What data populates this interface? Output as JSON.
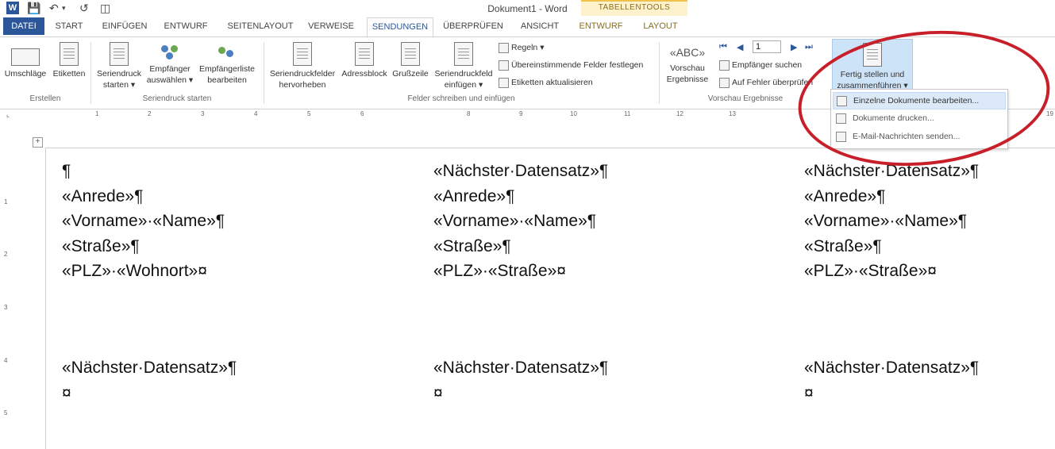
{
  "window": {
    "title": "Dokument1 - Word",
    "context_group": "TABELLENTOOLS"
  },
  "quick_access": {
    "icons": [
      "word-app-icon",
      "save-icon",
      "undo-icon",
      "redo-icon",
      "customize-icon"
    ]
  },
  "tabs": [
    {
      "label": "DATEI"
    },
    {
      "label": "START"
    },
    {
      "label": "EINFÜGEN"
    },
    {
      "label": "ENTWURF"
    },
    {
      "label": "SEITENLAYOUT"
    },
    {
      "label": "VERWEISE"
    },
    {
      "label": "SENDUNGEN"
    },
    {
      "label": "ÜBERPRÜFEN"
    },
    {
      "label": "ANSICHT"
    },
    {
      "label": "ENTWURF"
    },
    {
      "label": "LAYOUT"
    }
  ],
  "ribbon": {
    "groups": {
      "erstellen": "Erstellen",
      "seriendruck_starten": "Seriendruck starten",
      "felder": "Felder schreiben und einfügen",
      "vorschau": "Vorschau Ergebnisse"
    },
    "buttons": {
      "umschlaege": "Umschläge",
      "etiketten": "Etiketten",
      "seriendruck_1": "Seriendruck",
      "seriendruck_2": "starten",
      "empfaenger_1": "Empfänger",
      "empfaenger_2": "auswählen",
      "liste_1": "Empfängerliste",
      "liste_2": "bearbeiten",
      "hervorheben_1": "Seriendruckfelder",
      "hervorheben_2": "hervorheben",
      "adressblock": "Adressblock",
      "grusszeile": "Grußzeile",
      "feld_1": "Seriendruckfeld",
      "feld_2": "einfügen",
      "regeln": "Regeln",
      "uebereinstimmende": "Übereinstimmende Felder festlegen",
      "etiketten_akt": "Etiketten aktualisieren",
      "vorschau_1": "Vorschau",
      "vorschau_2": "Ergebnisse",
      "record_value": "1",
      "empfaenger_suchen": "Empfänger suchen",
      "auf_fehler": "Auf Fehler überprüfen",
      "fertig_1": "Fertig stellen und",
      "fertig_2": "zusammenführen"
    }
  },
  "dropdown": [
    {
      "label": "Einzelne Dokumente bearbeiten..."
    },
    {
      "label": "Dokumente drucken..."
    },
    {
      "label": "E-Mail-Nachrichten senden..."
    }
  ],
  "ruler": {
    "numbers": [
      "1",
      "2",
      "3",
      "4",
      "5",
      "6",
      "8",
      "9",
      "10",
      "11",
      "12",
      "13",
      "19"
    ],
    "vertical": [
      "1",
      "2",
      "3",
      "4",
      "5"
    ]
  },
  "labels": {
    "row1": [
      [
        "¶",
        "«Anrede»¶",
        "«Vorname»·«Name»¶",
        "«Straße»¶",
        "«PLZ»·«Wohnort»¤"
      ],
      [
        "«Nächster·Datensatz»¶",
        "«Anrede»¶",
        "«Vorname»·«Name»¶",
        "«Straße»¶",
        "«PLZ»·«Straße»¤"
      ],
      [
        "«Nächster·Datensatz»¶",
        "«Anrede»¶",
        "«Vorname»·«Name»¶",
        "«Straße»¶",
        "«PLZ»·«Straße»¤"
      ]
    ],
    "row2": [
      [
        "«Nächster·Datensatz»¶",
        "¤"
      ],
      [
        "«Nächster·Datensatz»¶",
        "¤"
      ],
      [
        "«Nächster·Datensatz»¶",
        "¤"
      ]
    ]
  },
  "colors": {
    "accent": "#2b579a",
    "highlight": "#c8202a",
    "selected_button": "#cde3f7"
  }
}
